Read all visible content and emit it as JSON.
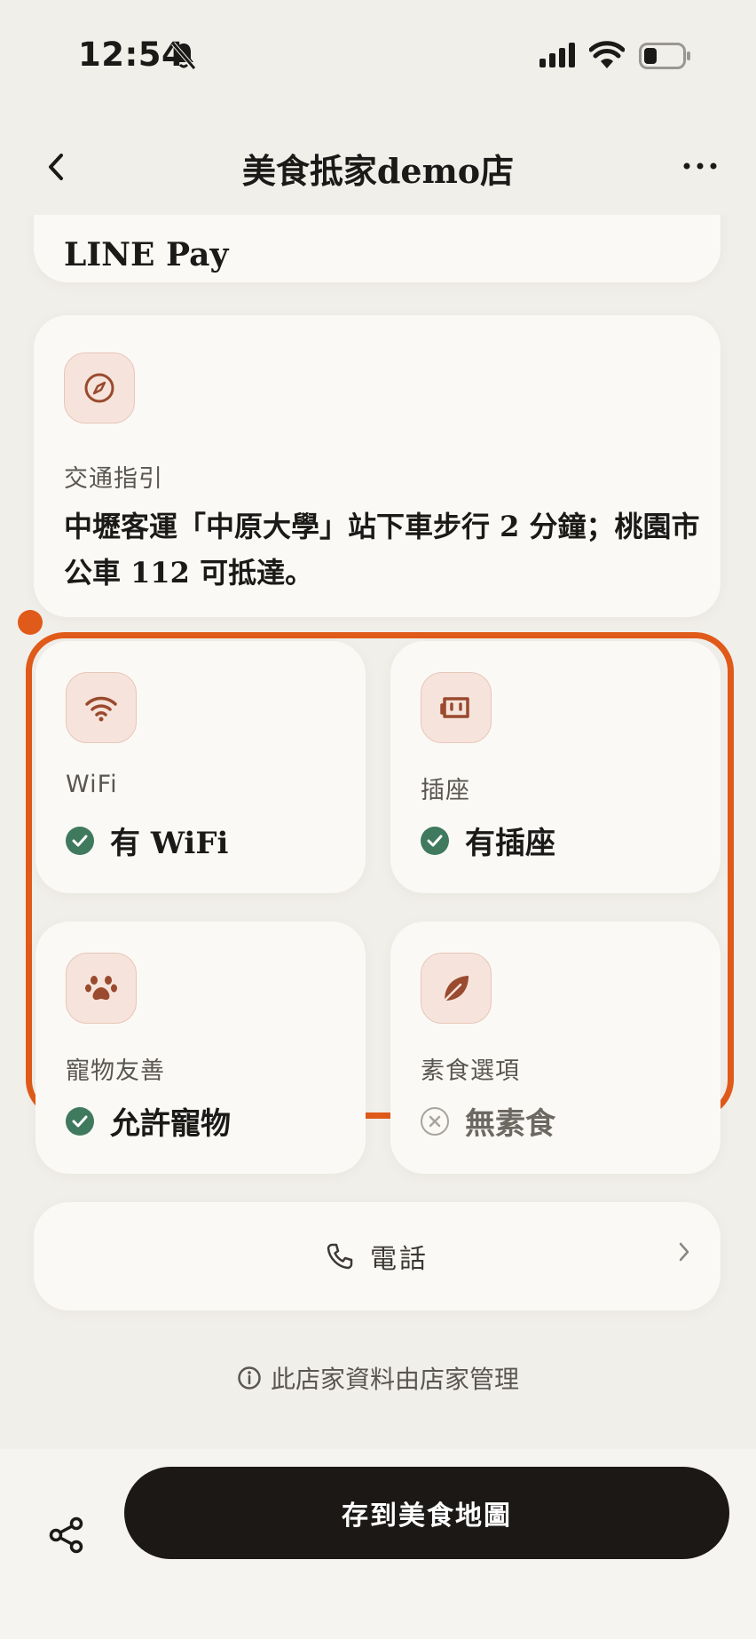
{
  "status_bar": {
    "time": "12:54",
    "icons": [
      "bell-slash-icon",
      "cellular-signal-icon",
      "wifi-icon",
      "battery-icon"
    ]
  },
  "nav": {
    "title": "美食抵家demo店",
    "back_icon": "chevron-left-icon",
    "more_icon": "more-horizontal-icon"
  },
  "payment": {
    "text": "LINE Pay"
  },
  "transit": {
    "icon": "compass-icon",
    "label": "交通指引",
    "text": "中壢客運「中原大學」站下車步行 2 分鐘；桃園市公車 112 可抵達。"
  },
  "amenities": [
    {
      "icon": "wifi-icon",
      "label": "WiFi",
      "status": "有 WiFi",
      "available": true
    },
    {
      "icon": "power-socket-icon",
      "label": "插座",
      "status": "有插座",
      "available": true
    },
    {
      "icon": "paw-icon",
      "label": "寵物友善",
      "status": "允許寵物",
      "available": true
    },
    {
      "icon": "leaf-icon",
      "label": "素食選項",
      "status": "無素食",
      "available": false
    }
  ],
  "phone": {
    "label": "電話",
    "icon": "phone-icon"
  },
  "footnote": {
    "text": "此店家資料由店家管理",
    "icon": "info-icon"
  },
  "bottom_bar": {
    "share_icon": "share-icon",
    "save_label": "存到美食地圖"
  },
  "colors": {
    "background": "#f1efea",
    "card": "#fbf9f6",
    "highlight": "#e05a1a",
    "icon_accent": "#9a4a2e",
    "check_green": "#3f7a5e",
    "primary_button": "#1b1816"
  }
}
